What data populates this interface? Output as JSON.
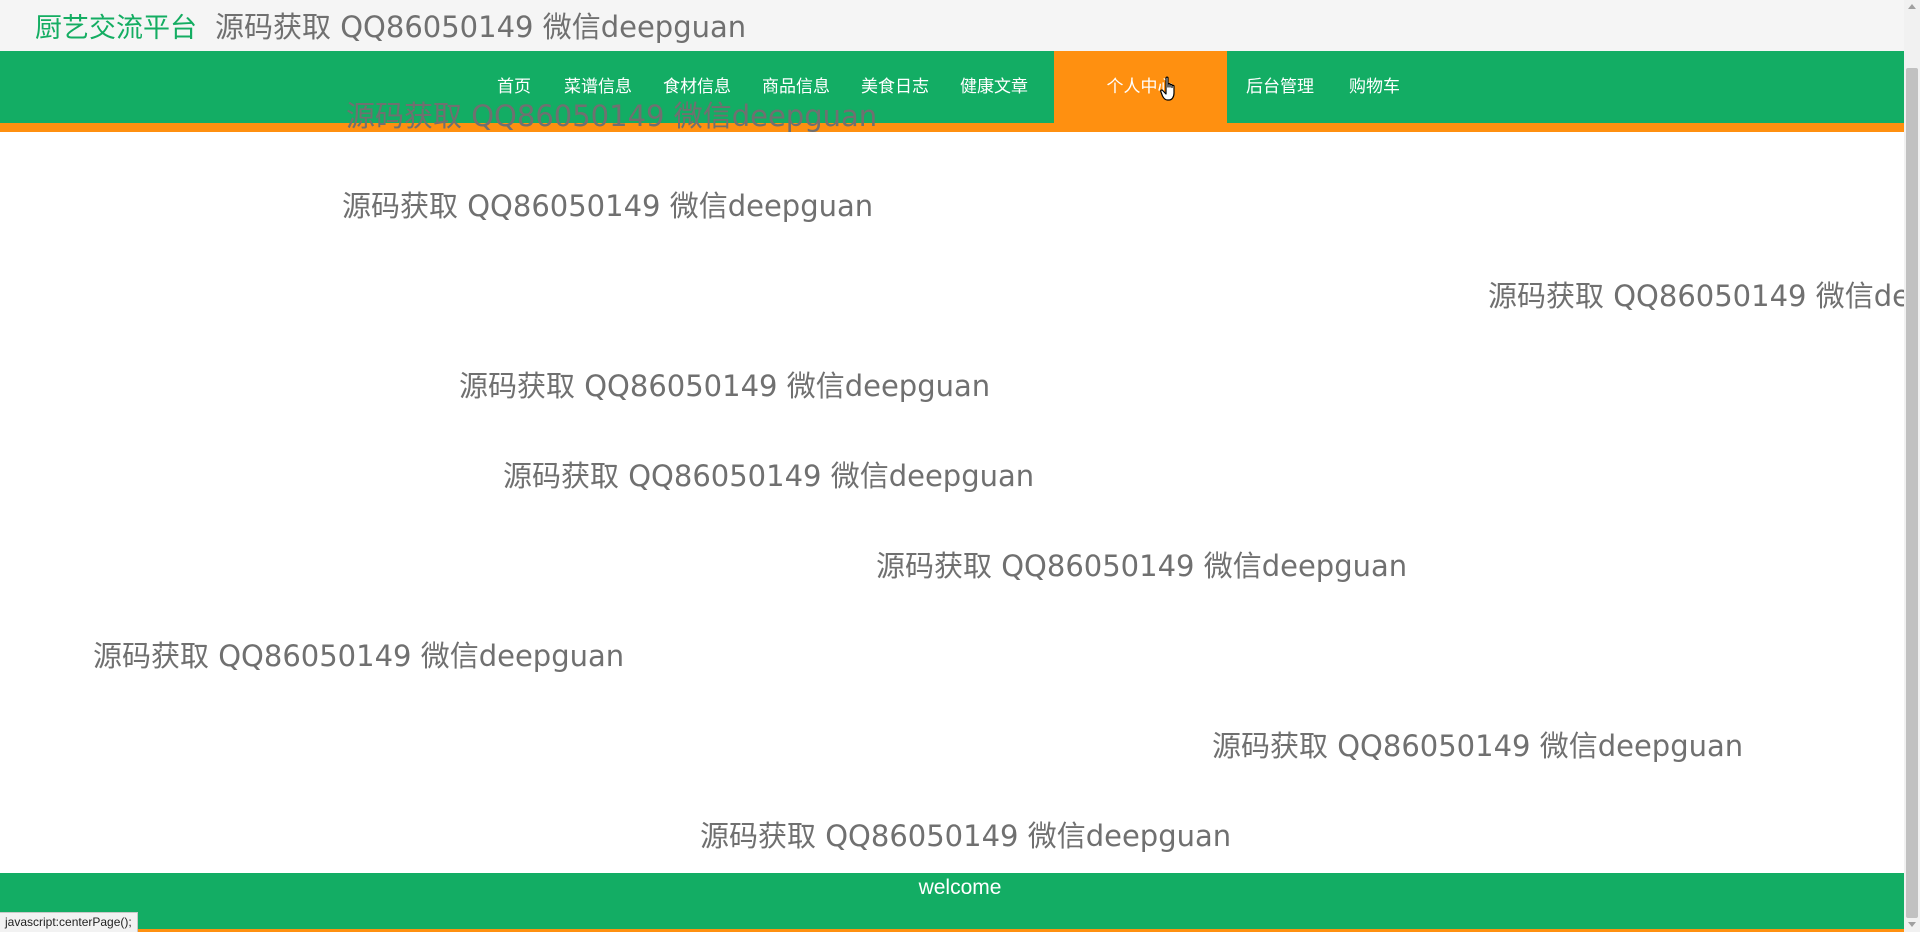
{
  "header": {
    "site_title": "厨艺交流平台"
  },
  "nav": {
    "items": [
      {
        "label": "首页"
      },
      {
        "label": "菜谱信息"
      },
      {
        "label": "食材信息"
      },
      {
        "label": "商品信息"
      },
      {
        "label": "美食日志"
      },
      {
        "label": "健康文章"
      },
      {
        "label": "个人中心",
        "active": true
      },
      {
        "label": "后台管理"
      },
      {
        "label": "购物车"
      }
    ]
  },
  "watermark_text": "源码获取 QQ86050149 微信deepguan",
  "footer": {
    "text": "welcome"
  },
  "status_bar": {
    "text": "javascript:centerPage();"
  },
  "colors": {
    "brand_green": "#13ad64",
    "accent_orange": "#ff9010",
    "watermark_gray": "#707070"
  },
  "icons": {
    "cursor": "hand-pointer-icon"
  }
}
